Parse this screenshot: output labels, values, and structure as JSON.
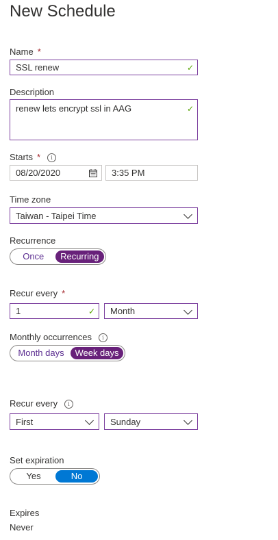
{
  "page_title": "New Schedule",
  "name": {
    "label": "Name",
    "required_mark": "*",
    "value": "SSL renew"
  },
  "description": {
    "label": "Description",
    "value": "renew lets encrypt ssl in AAG"
  },
  "starts": {
    "label": "Starts",
    "required_mark": "*",
    "date": "08/20/2020",
    "time": "3:35 PM"
  },
  "time_zone": {
    "label": "Time zone",
    "value": "Taiwan - Taipei Time"
  },
  "recurrence": {
    "label": "Recurrence",
    "options": [
      "Once",
      "Recurring"
    ],
    "selected": "Recurring"
  },
  "recur_every": {
    "label": "Recur every",
    "required_mark": "*",
    "interval": "1",
    "unit": "Month"
  },
  "monthly_occurrences": {
    "label": "Monthly occurrences",
    "options": [
      "Month days",
      "Week days"
    ],
    "selected": "Week days"
  },
  "recur_every_week": {
    "label": "Recur every",
    "ordinal": "First",
    "day": "Sunday"
  },
  "set_expiration": {
    "label": "Set expiration",
    "options": [
      "Yes",
      "No"
    ],
    "selected": "No"
  },
  "expires": {
    "label": "Expires",
    "value": "Never"
  },
  "colors": {
    "accent_purple": "#68217a",
    "accent_blue": "#0078d4",
    "valid_green": "#57a300",
    "required_red": "#a4262c"
  }
}
